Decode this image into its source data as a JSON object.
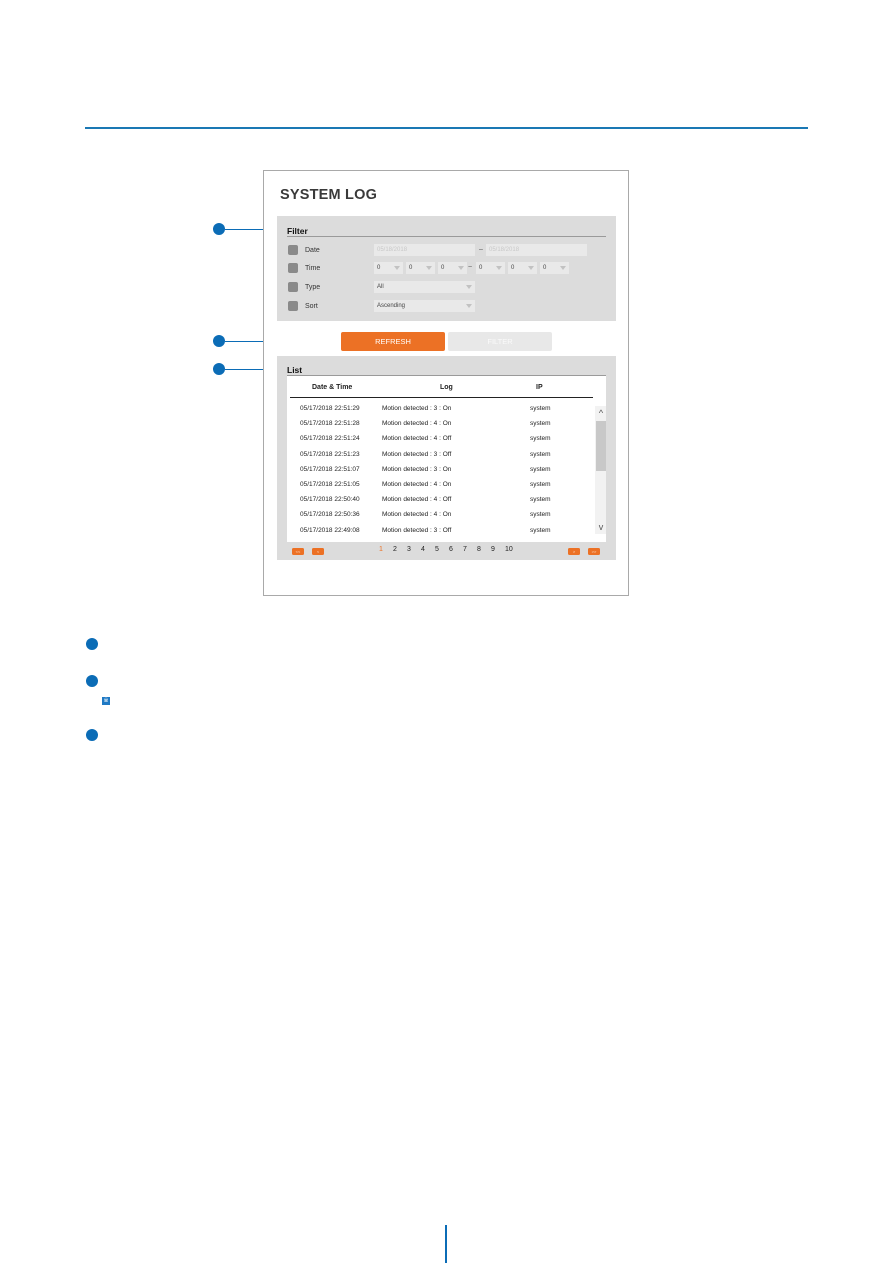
{
  "app": {
    "title": "SYSTEM LOG"
  },
  "filter": {
    "heading": "Filter",
    "rows": [
      {
        "label": "Date"
      },
      {
        "label": "Time"
      },
      {
        "label": "Type"
      },
      {
        "label": "Sort"
      }
    ],
    "date_from_placeholder": "05/18/2018",
    "date_to_placeholder": "05/18/2018",
    "date_separator": "–",
    "time_separator": "~",
    "time_from": [
      "0",
      "0",
      "0"
    ],
    "time_to": [
      "0",
      "0",
      "0"
    ],
    "type_value": "All",
    "sort_value": "Ascending"
  },
  "buttons": {
    "refresh": "REFRESH",
    "filter": "FILTER"
  },
  "list": {
    "heading": "List",
    "columns": [
      "Date & Time",
      "Log",
      "IP"
    ],
    "rows": [
      {
        "datetime": "05/17/2018 22:51:29",
        "log": "Motion detected : 3 : On",
        "ip": "system"
      },
      {
        "datetime": "05/17/2018 22:51:28",
        "log": "Motion detected : 4 : On",
        "ip": "system"
      },
      {
        "datetime": "05/17/2018 22:51:24",
        "log": "Motion detected : 4 : Off",
        "ip": "system"
      },
      {
        "datetime": "05/17/2018 22:51:23",
        "log": "Motion detected : 3 : Off",
        "ip": "system"
      },
      {
        "datetime": "05/17/2018 22:51:07",
        "log": "Motion detected : 3 : On",
        "ip": "system"
      },
      {
        "datetime": "05/17/2018 22:51:05",
        "log": "Motion detected : 4 : On",
        "ip": "system"
      },
      {
        "datetime": "05/17/2018 22:50:40",
        "log": "Motion detected : 4 : Off",
        "ip": "system"
      },
      {
        "datetime": "05/17/2018 22:50:36",
        "log": "Motion detected : 4 : On",
        "ip": "system"
      },
      {
        "datetime": "05/17/2018 22:49:08",
        "log": "Motion detected : 3 : Off",
        "ip": "system"
      }
    ]
  },
  "pagination": {
    "first": "<<",
    "prev": "<",
    "next": ">",
    "last": ">>",
    "pages": [
      "1",
      "2",
      "3",
      "4",
      "5",
      "6",
      "7",
      "8",
      "9",
      "10"
    ],
    "current_page": "1"
  },
  "scrollbar": {
    "up": "^",
    "down": "v"
  },
  "notes": {
    "note_icon": "※"
  },
  "colors": {
    "accent_orange": "#ec7125",
    "callout_blue": "#0b6cb6",
    "rule_blue": "#1a78b4"
  }
}
